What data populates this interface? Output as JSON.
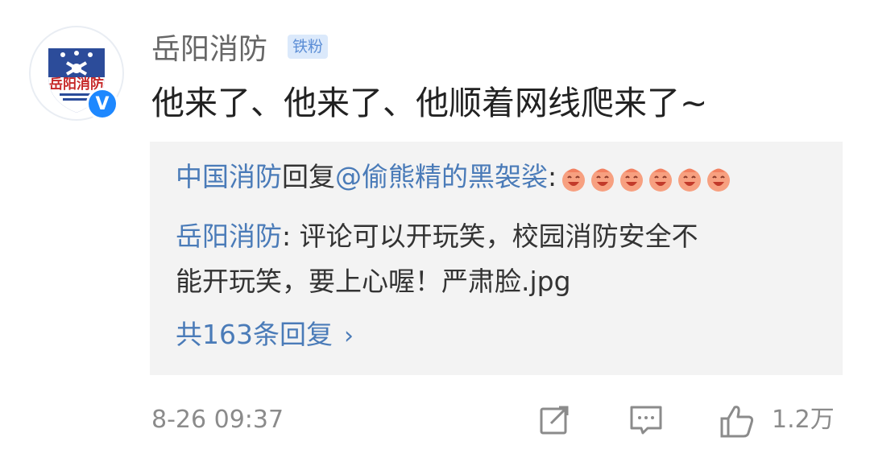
{
  "post": {
    "author": "岳阳消防",
    "badge": "铁粉",
    "avatar_text": "岳阳消防",
    "verified_mark": "V",
    "text": "他来了、他来了、他顺着网线爬来了~"
  },
  "reply_preview": {
    "line1": {
      "name": "中国消防",
      "action": "回复",
      "mention": "@偷熊精的黑袈裟",
      "colon": ":",
      "emoji_count": 6,
      "emoji_icon": "laughing-face-emoji"
    },
    "line2": {
      "name": "岳阳消防",
      "text": ": 评论可以开玩笑，校园消防安全不"
    },
    "line3": {
      "text": "能开玩笑，要上心喔！严肃脸.jpg"
    },
    "more": {
      "label": "共163条回复",
      "icon": "chevron-right-icon"
    }
  },
  "footer": {
    "time": "8-26 09:37",
    "actions": [
      {
        "icon": "share-icon"
      },
      {
        "icon": "comment-icon"
      },
      {
        "icon": "thumbs-up-icon",
        "count": "1.2万"
      }
    ]
  },
  "colors": {
    "link": "#4a7bb8",
    "badge_bg": "#dbe9fb",
    "verified": "#1e88ff",
    "reply_bg": "#f3f3f3"
  }
}
